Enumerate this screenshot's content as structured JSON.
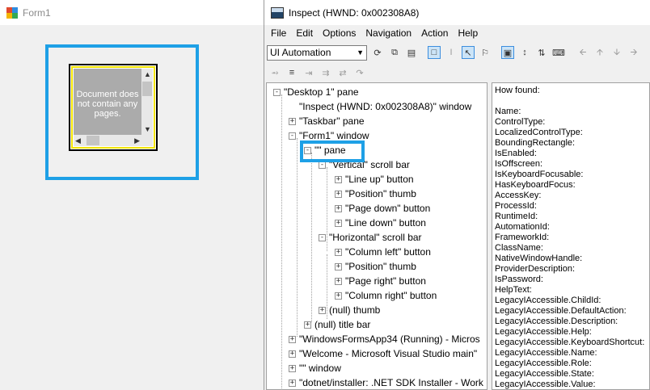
{
  "form1": {
    "title": "Form1",
    "doc_message": "Document does not contain any pages."
  },
  "inspect": {
    "title": "Inspect  (HWND: 0x002308A8)",
    "menu": [
      "File",
      "Edit",
      "Options",
      "Navigation",
      "Action",
      "Help"
    ],
    "mode_select": "UI Automation",
    "tree": [
      {
        "label": "\"Desktop 1\" pane",
        "exp": "-"
      },
      {
        "label": "\"Inspect  (HWND: 0x002308A8)\" window",
        "exp": ""
      },
      {
        "label": "\"Taskbar\" pane",
        "exp": "+"
      },
      {
        "label": "\"Form1\" window",
        "exp": "-"
      },
      {
        "label": "\"\" pane",
        "exp": "-"
      },
      {
        "label": "\"Vertical\" scroll bar",
        "exp": "-"
      },
      {
        "label": "\"Line up\" button",
        "exp": "+"
      },
      {
        "label": "\"Position\" thumb",
        "exp": "+"
      },
      {
        "label": "\"Page down\" button",
        "exp": "+"
      },
      {
        "label": "\"Line down\" button",
        "exp": "+"
      },
      {
        "label": "\"Horizontal\" scroll bar",
        "exp": "-"
      },
      {
        "label": "\"Column left\" button",
        "exp": "+"
      },
      {
        "label": "\"Position\" thumb",
        "exp": "+"
      },
      {
        "label": "\"Page right\" button",
        "exp": "+"
      },
      {
        "label": "\"Column right\" button",
        "exp": "+"
      },
      {
        "label": "(null) thumb",
        "exp": "+"
      },
      {
        "label": "(null) title bar",
        "exp": "+"
      },
      {
        "label": "\"WindowsFormsApp34 (Running) - Micros",
        "exp": "+"
      },
      {
        "label": "\"Welcome - Microsoft Visual Studio main\"",
        "exp": "+"
      },
      {
        "label": "\"\" window",
        "exp": "+"
      },
      {
        "label": "\"dotnet/installer: .NET SDK Installer - Work",
        "exp": "+"
      }
    ],
    "properties": [
      "How found:",
      "",
      "Name:",
      "ControlType:",
      "LocalizedControlType:",
      "BoundingRectangle:",
      "IsEnabled:",
      "IsOffscreen:",
      "IsKeyboardFocusable:",
      "HasKeyboardFocus:",
      "AccessKey:",
      "ProcessId:",
      "RuntimeId:",
      "AutomationId:",
      "FrameworkId:",
      "ClassName:",
      "NativeWindowHandle:",
      "ProviderDescription:",
      "IsPassword:",
      "HelpText:",
      "LegacyIAccessible.ChildId:",
      "LegacyIAccessible.DefaultAction:",
      "LegacyIAccessible.Description:",
      "LegacyIAccessible.Help:",
      "LegacyIAccessible.KeyboardShortcut:",
      "LegacyIAccessible.Name:",
      "LegacyIAccessible.Role:",
      "LegacyIAccessible.State:",
      "LegacyIAccessible.Value:"
    ]
  },
  "colors": {
    "highlight": "#1ea0e6",
    "doc_border_yellow": "#f2e300"
  }
}
